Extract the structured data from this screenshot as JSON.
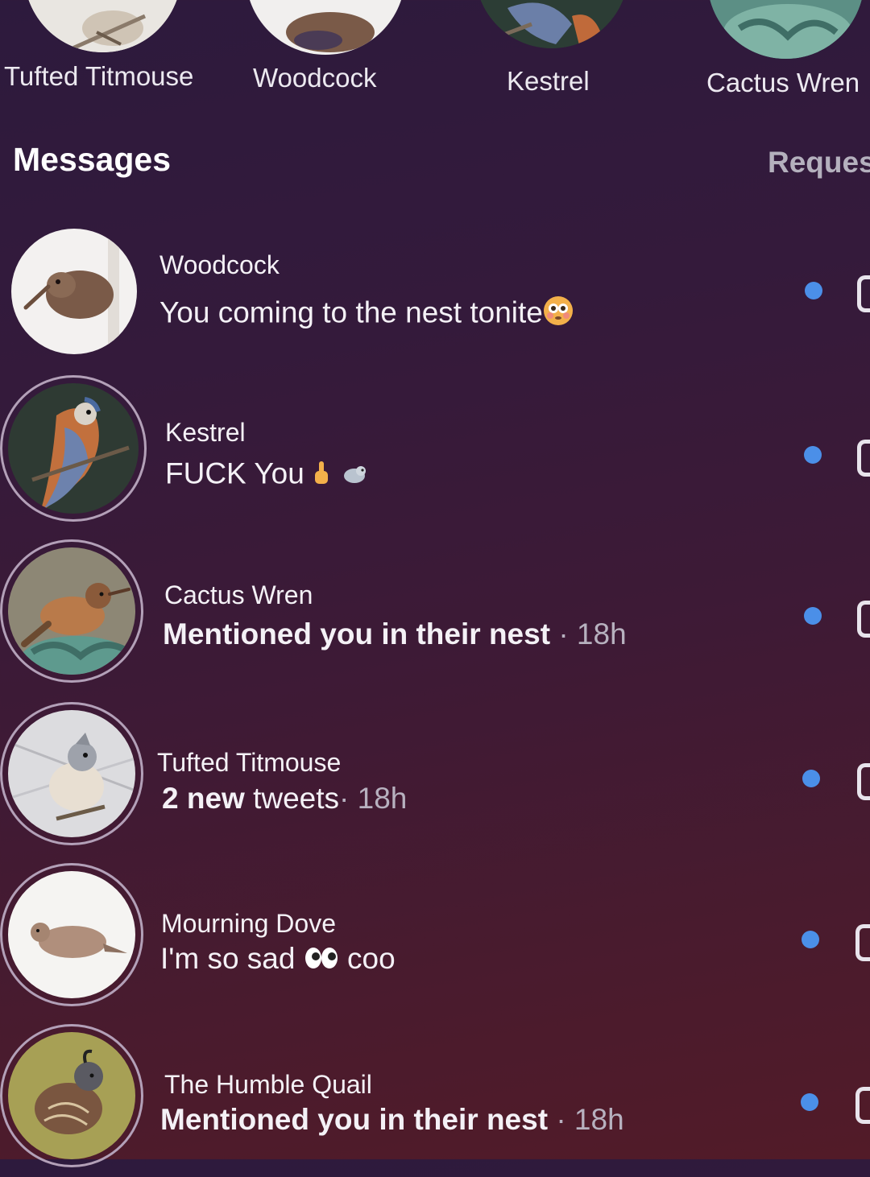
{
  "stories": [
    {
      "label": "Tufted Titmouse",
      "avatar": "tufted-titmouse-avatar"
    },
    {
      "label": "Woodcock",
      "avatar": "woodcock-avatar"
    },
    {
      "label": "Kestrel",
      "avatar": "kestrel-avatar"
    },
    {
      "label": "Cactus Wren",
      "avatar": "cactus-wren-avatar"
    }
  ],
  "header": {
    "title": "Messages",
    "requests": "Reques"
  },
  "threads": [
    {
      "name": "Woodcock",
      "preview": "You coming to the nest tonite",
      "emoji": "flushed-face-emoji",
      "time": "",
      "avatar": "woodcock-avatar"
    },
    {
      "name": "Kestrel",
      "preview": "FUCK You",
      "emoji": "middle-finger-and-bird-emoji",
      "time": "",
      "avatar": "kestrel-avatar"
    },
    {
      "name": "Cactus Wren",
      "preview": "Mentioned you in their nest",
      "emoji": "",
      "time": "· 18h",
      "avatar": "cactus-wren-avatar"
    },
    {
      "name": "Tufted Titmouse",
      "preview_bold": "2 new",
      "preview_rest": "tweets",
      "time": "· 18h",
      "avatar": "tufted-titmouse-avatar"
    },
    {
      "name": "Mourning Dove",
      "preview": "I'm so sad",
      "emoji": "eyes-emoji",
      "preview_after": "coo",
      "time": "",
      "avatar": "mourning-dove-avatar"
    },
    {
      "name": "The Humble Quail",
      "preview": "Mentioned you in their nest",
      "emoji": "",
      "time": "· 18h",
      "avatar": "quail-avatar"
    }
  ],
  "colors": {
    "unread_dot": "#4b8fe8",
    "background_top": "#2d1a3d",
    "background_bottom": "#521b28"
  }
}
